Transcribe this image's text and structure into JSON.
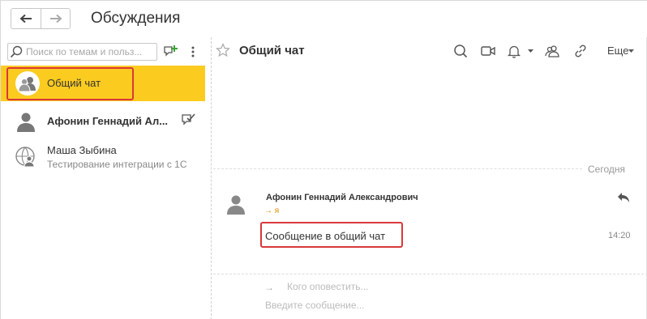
{
  "header": {
    "title": "Обсуждения"
  },
  "sidebar": {
    "search": {
      "placeholder": "Поиск по темам и польз..."
    },
    "conversations": [
      {
        "title": "Общий чат",
        "subtitle": ""
      },
      {
        "title": "Афонин Геннадий Ал...",
        "subtitle": ""
      },
      {
        "title": "Маша Зыбина",
        "subtitle": "Тестирование интеграции с 1С"
      }
    ]
  },
  "chat": {
    "title": "Общий чат",
    "more_label": "Еще",
    "date_separator": "Сегодня",
    "message": {
      "author": "Афонин Геннадий Александрович",
      "recipient": "→ я",
      "text": "Сообщение в общий чат",
      "time": "14:20"
    },
    "composer": {
      "notify_arrow": "→",
      "notify_placeholder": "Кого оповестить...",
      "message_placeholder": "Введите сообщение..."
    }
  },
  "colors": {
    "active_row": "#fccb1f",
    "highlight": "#d9383a",
    "accent_green": "#3aa335",
    "recipient": "#e08a00"
  }
}
